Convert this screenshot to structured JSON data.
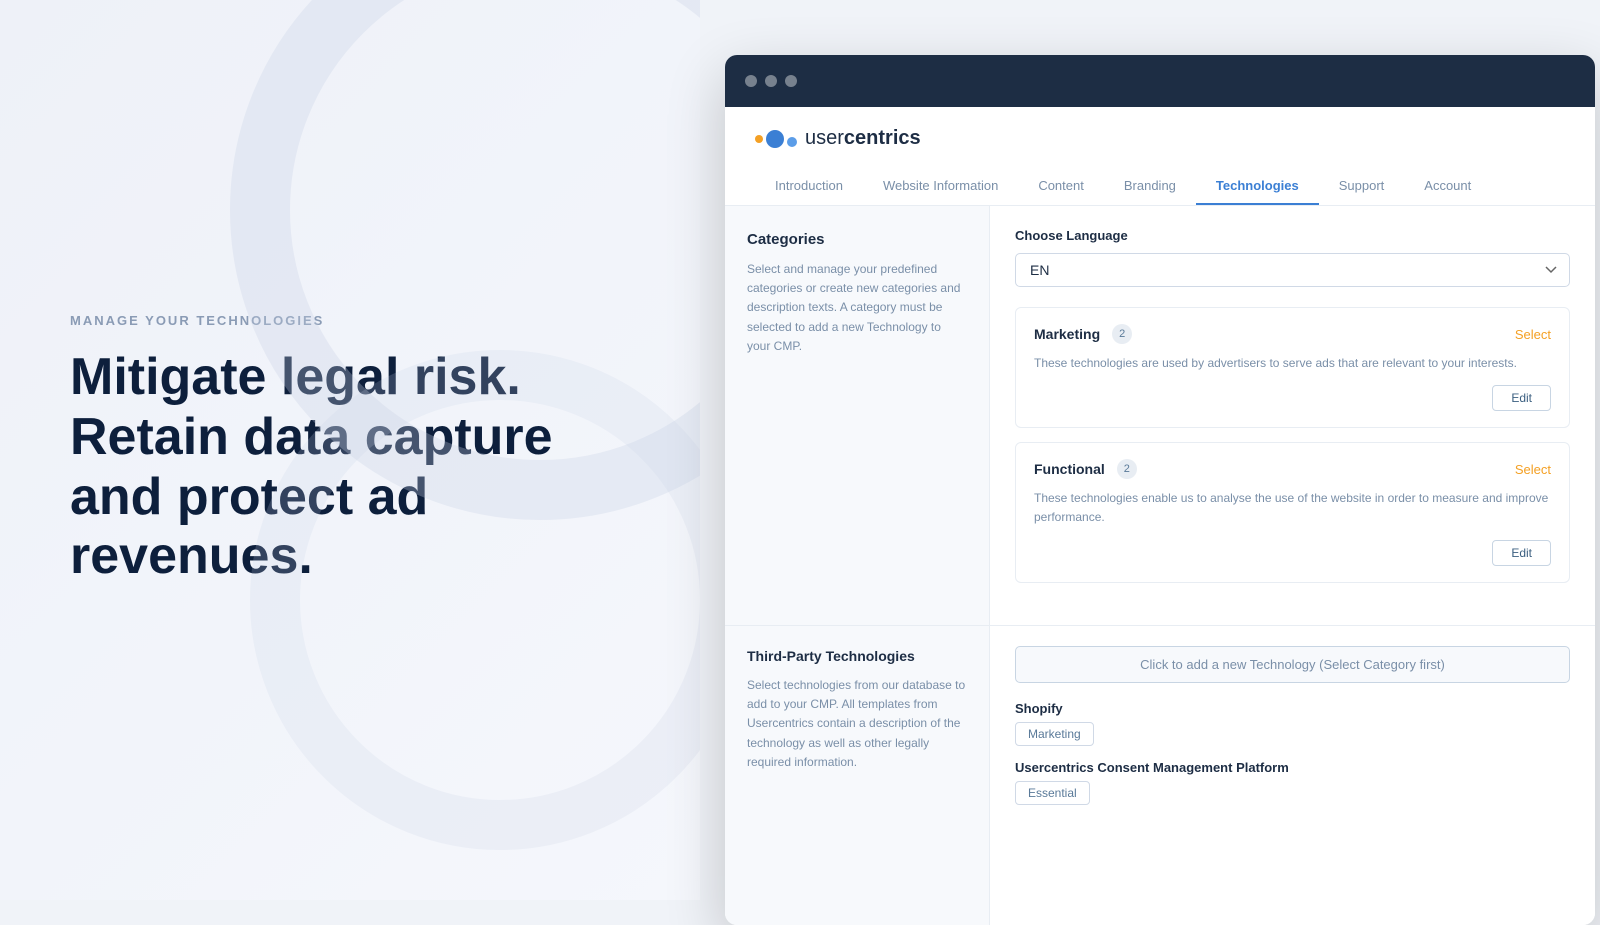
{
  "left": {
    "subtitle": "MANAGE YOUR TECHNOLOGIES",
    "heading": "Mitigate legal risk. Retain data capture and protect ad revenues."
  },
  "browser": {
    "logo_text_normal": "user",
    "logo_text_bold": "centrics",
    "nav_tabs": [
      {
        "id": "introduction",
        "label": "Introduction",
        "active": false
      },
      {
        "id": "website-information",
        "label": "Website Information",
        "active": false
      },
      {
        "id": "content",
        "label": "Content",
        "active": false
      },
      {
        "id": "branding",
        "label": "Branding",
        "active": false
      },
      {
        "id": "technologies",
        "label": "Technologies",
        "active": true
      },
      {
        "id": "support",
        "label": "Support",
        "active": false
      },
      {
        "id": "account",
        "label": "Account",
        "active": false
      }
    ],
    "left_panel": {
      "title": "Categories",
      "description": "Select and manage your predefined categories or create new categories and description texts. A category must be selected to add a new Technology to your CMP."
    },
    "right_panel": {
      "choose_language_label": "Choose Language",
      "language_value": "EN",
      "categories": [
        {
          "name": "Marketing",
          "count": 2,
          "description": "These technologies are used by advertisers to serve ads that are relevant to your interests.",
          "select_label": "Select",
          "edit_label": "Edit"
        },
        {
          "name": "Functional",
          "count": 2,
          "description": "These technologies enable us to analyse the use of the website in order to measure and improve performance.",
          "select_label": "Select",
          "edit_label": "Edit"
        }
      ]
    },
    "bottom_left": {
      "title": "Third-Party Technologies",
      "description": "Select technologies from our database to add to your CMP. All templates from Usercentrics contain a description of the technology as well as other legally required information."
    },
    "bottom_right": {
      "add_tech_placeholder": "Click to add a new Technology (Select Category first)",
      "technologies": [
        {
          "name": "Shopify",
          "category": "Marketing"
        },
        {
          "name": "Usercentrics Consent Management Platform",
          "category": "Essential"
        }
      ]
    }
  }
}
